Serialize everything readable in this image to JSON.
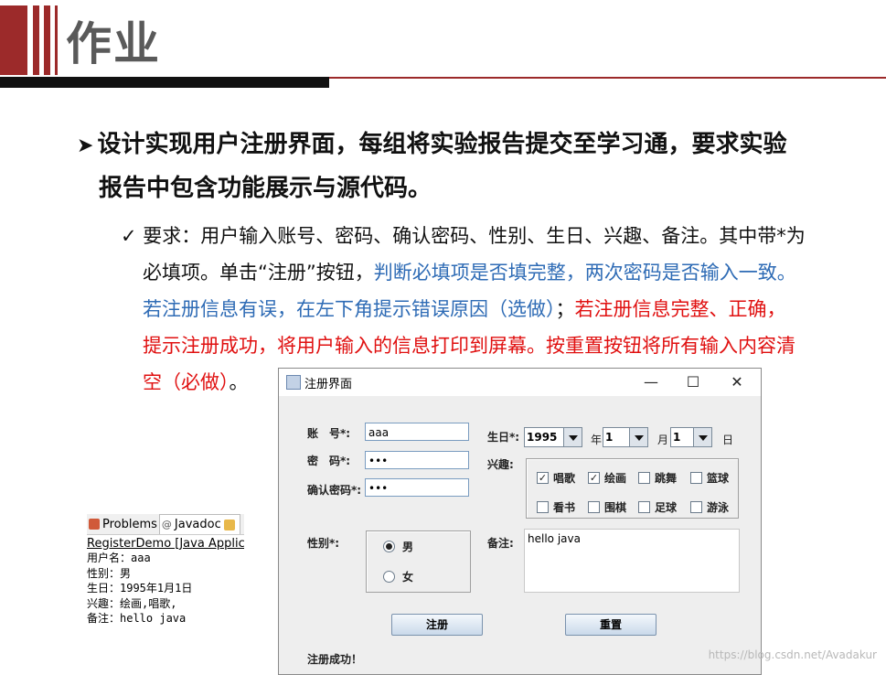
{
  "slide": {
    "title": "作业",
    "bullet_line1": "设计实现用户注册界面，每组将实验报告提交至学习通，要求实验",
    "bullet_line2": "报告中包含功能展示与源代码。",
    "sub_black1": "要求：用户输入账号、密码、确认密码、性别、生日、兴趣、备注。其中带*为",
    "sub_black2": "必填项。单击“注册”按钮，",
    "sub_blue1": "判断必填项是否填完整，两次密码是否输入一致。",
    "sub_blue2": "若注册信息有误，在左下角提示错误原因（选做）",
    "sub_black3": "；",
    "sub_red1": "若注册信息完整、正确，",
    "sub_red2": "提示注册成功，将用户输入的信息打印到屏幕。按重置按钮将所有输入内容清",
    "sub_red3": "空（必做）",
    "sub_black4": "。"
  },
  "console": {
    "tab_problems": "Problems",
    "tab_javadoc": "Javadoc",
    "run_label": "RegisterDemo [Java Applicat",
    "lines": [
      "用户名：aaa",
      "性别：男",
      "生日：1995年1月1日",
      "兴趣：绘画,唱歌,",
      "备注：hello java"
    ]
  },
  "window": {
    "title": "注册界面",
    "min": "—",
    "max": "☐",
    "close": "✕",
    "account_label": "账　号*:",
    "account_value": "aaa",
    "password_label": "密　码*:",
    "password_value": "•••",
    "confirm_label": "确认密码*:",
    "confirm_value": "•••",
    "birthday_label": "生日*:",
    "year_value": "1995",
    "year_unit": "年",
    "month_value": "1",
    "month_unit": "月",
    "day_value": "1",
    "day_unit": "日",
    "interest_label": "兴趣:",
    "interests": [
      {
        "label": "唱歌",
        "checked": true
      },
      {
        "label": "绘画",
        "checked": true
      },
      {
        "label": "跳舞",
        "checked": false
      },
      {
        "label": "篮球",
        "checked": false
      },
      {
        "label": "看书",
        "checked": false
      },
      {
        "label": "围棋",
        "checked": false
      },
      {
        "label": "足球",
        "checked": false
      },
      {
        "label": "游泳",
        "checked": false
      }
    ],
    "gender_label": "性别*:",
    "gender_male": "男",
    "gender_female": "女",
    "gender_selected": "男",
    "remark_label": "备注:",
    "remark_value": "hello java",
    "register_button": "注册",
    "reset_button": "重置",
    "status": "注册成功！",
    "check_mark": "✓"
  },
  "watermark": "https://blog.csdn.net/Avadakur"
}
